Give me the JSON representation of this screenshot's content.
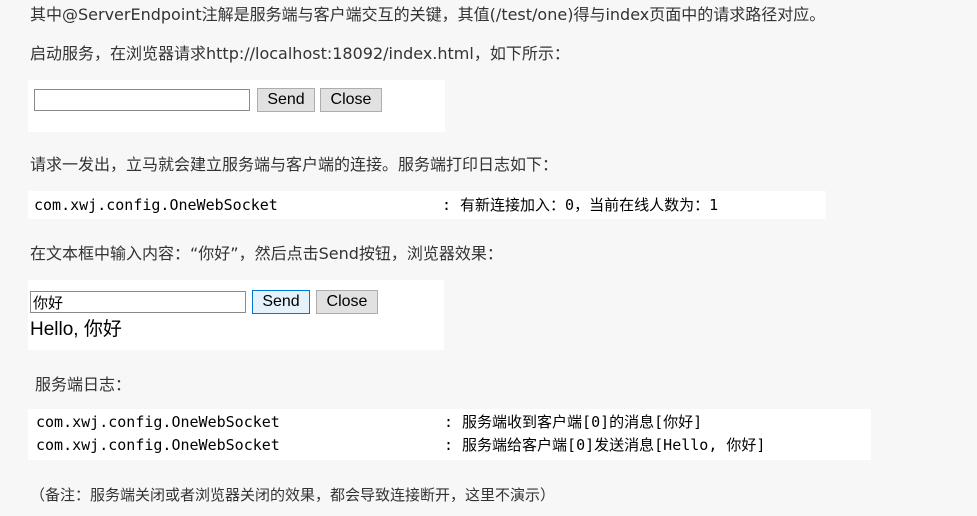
{
  "paragraphs": {
    "p1": "其中@ServerEndpoint注解是服务端与客户端交互的关键，其值(/test/one)得与index页面中的请求路径对应。",
    "p2": "启动服务，在浏览器请求http://localhost:18092/index.html，如下所示：",
    "p3": "请求一发出，立马就会建立服务端与客户端的连接。服务端打印日志如下：",
    "p4": "在文本框中输入内容：“你好”，然后点击Send按钮，浏览器效果：",
    "p5": "服务端日志：",
    "p6": "（备注：服务端关闭或者浏览器关闭的效果，都会导致连接断开，这里不演示）"
  },
  "demo1": {
    "input_value": "",
    "send_label": "Send",
    "close_label": "Close"
  },
  "log1": {
    "class": "com.xwj.config.OneWebSocket",
    "message": ": 有新连接加入：0，当前在线人数为：1"
  },
  "demo2": {
    "input_value": "你好",
    "send_label": "Send",
    "close_label": "Close",
    "response": "Hello, 你好"
  },
  "log2": [
    {
      "class": "com.xwj.config.OneWebSocket",
      "message": ": 服务端收到客户端[0]的消息[你好]"
    },
    {
      "class": "com.xwj.config.OneWebSocket",
      "message": ": 服务端给客户端[0]发送消息[Hello, 你好]"
    }
  ]
}
